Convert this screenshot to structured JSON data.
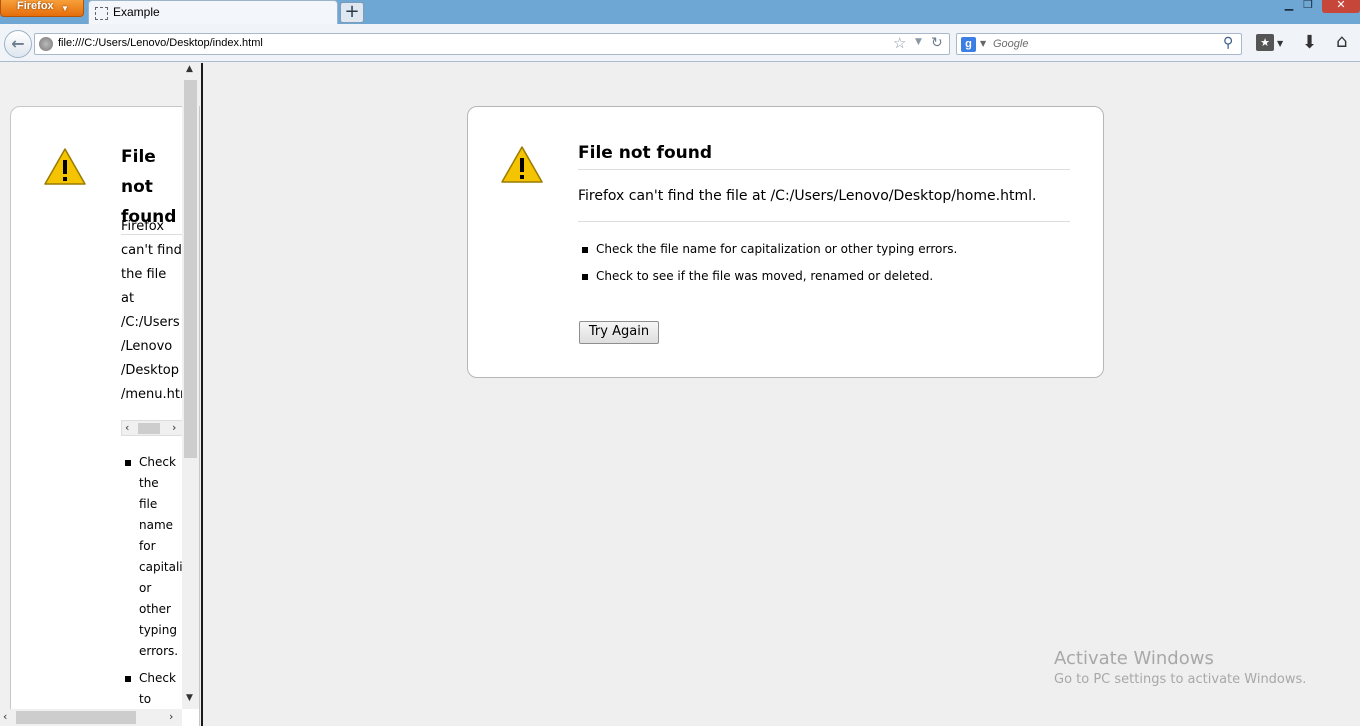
{
  "browser": {
    "menu_label": "Firefox",
    "tab_title": "Example",
    "url": "file:///C:/Users/Lenovo/Desktop/index.html",
    "search_placeholder": "Google",
    "new_tab_symbol": "+"
  },
  "frame": {
    "title_line1": "File not",
    "title_line2": "found",
    "desc_lines": [
      "Firefox",
      "can't find",
      "the file",
      "at",
      "/C:/Users",
      "/Lenovo",
      "/Desktop",
      "/menu.htm"
    ],
    "bullets": [
      [
        "Check",
        "the",
        "file",
        "name",
        "for",
        "capitaliz",
        "or",
        "other",
        "typing",
        "errors."
      ],
      [
        "Check",
        "to"
      ]
    ]
  },
  "error": {
    "title": "File not found",
    "description": "Firefox can't find the file at /C:/Users/Lenovo/Desktop/home.html.",
    "suggestions": [
      "Check the file name for capitalization or other typing errors.",
      "Check to see if the file was moved, renamed or deleted."
    ],
    "button": "Try Again"
  },
  "watermark": {
    "title": "Activate Windows",
    "subtitle": "Go to PC settings to activate Windows."
  },
  "colors": {
    "titlebar": "#6ea6d4",
    "firefox_button": "#e56d0a",
    "warning_yellow": "#f5c400",
    "page_background": "#efefef"
  }
}
